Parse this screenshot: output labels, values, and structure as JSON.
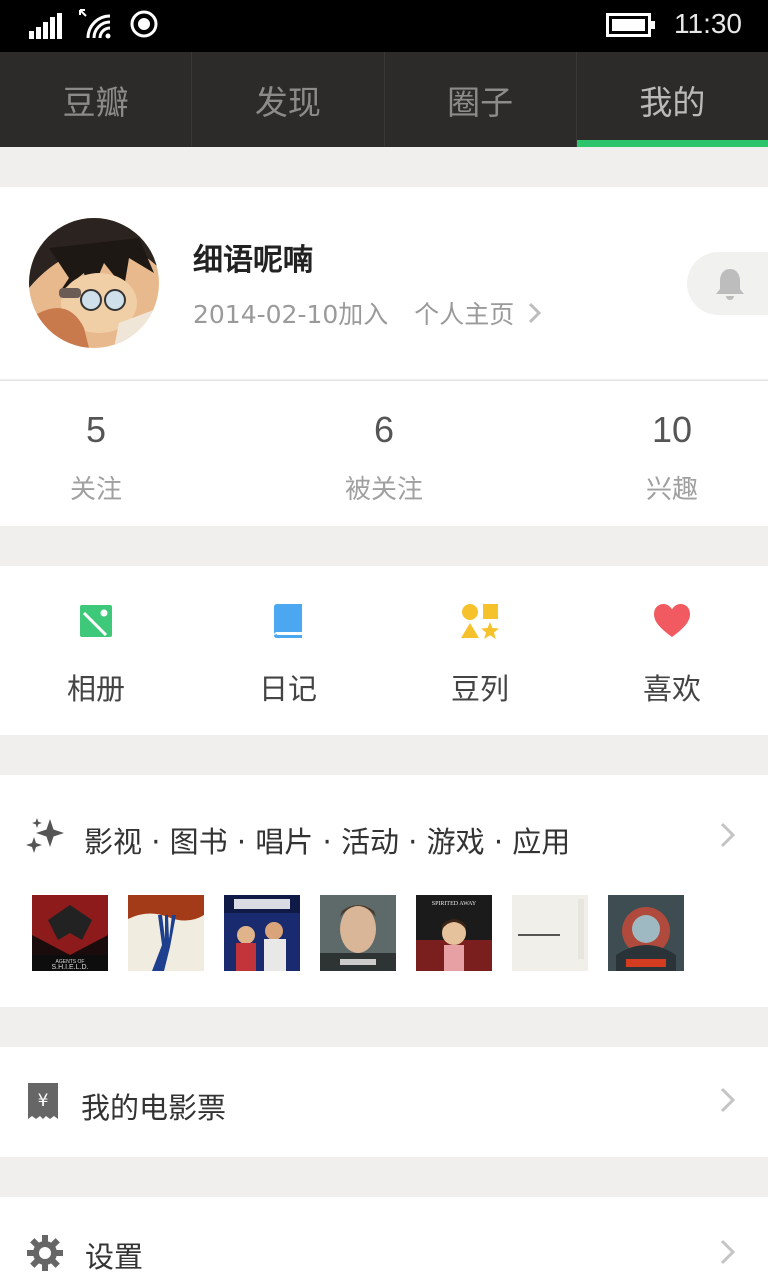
{
  "status_bar": {
    "time": "11:30"
  },
  "tabs": [
    {
      "label": "豆瓣"
    },
    {
      "label": "发现"
    },
    {
      "label": "圈子"
    },
    {
      "label": "我的"
    }
  ],
  "active_tab_index": 3,
  "accent_color": "#2ec46b",
  "profile": {
    "name": "细语呢喃",
    "joined": "2014-02-10加入",
    "homepage_link": "个人主页"
  },
  "stats": [
    {
      "value": "5",
      "label": "关注"
    },
    {
      "value": "6",
      "label": "被关注"
    },
    {
      "value": "10",
      "label": "兴趣"
    }
  ],
  "shortcuts": [
    {
      "label": "相册",
      "icon": "photo-album-icon",
      "color": "#3ec87a"
    },
    {
      "label": "日记",
      "icon": "diary-book-icon",
      "color": "#4aa7f0"
    },
    {
      "label": "豆列",
      "icon": "shapes-icon",
      "color": "#f6c22c"
    },
    {
      "label": "喜欢",
      "icon": "heart-icon",
      "color": "#f05a60"
    }
  ],
  "media": {
    "title": "影视 · 图书 · 唱片 · 活动 · 游戏 · 应用",
    "posters": [
      "Agents of S.H.I.E.L.D.",
      "poster-2",
      "poster-3",
      "poster-4",
      "Spirited Away",
      "poster-6",
      "poster-7"
    ]
  },
  "rows": {
    "tickets": "我的电影票",
    "settings": "设置"
  }
}
